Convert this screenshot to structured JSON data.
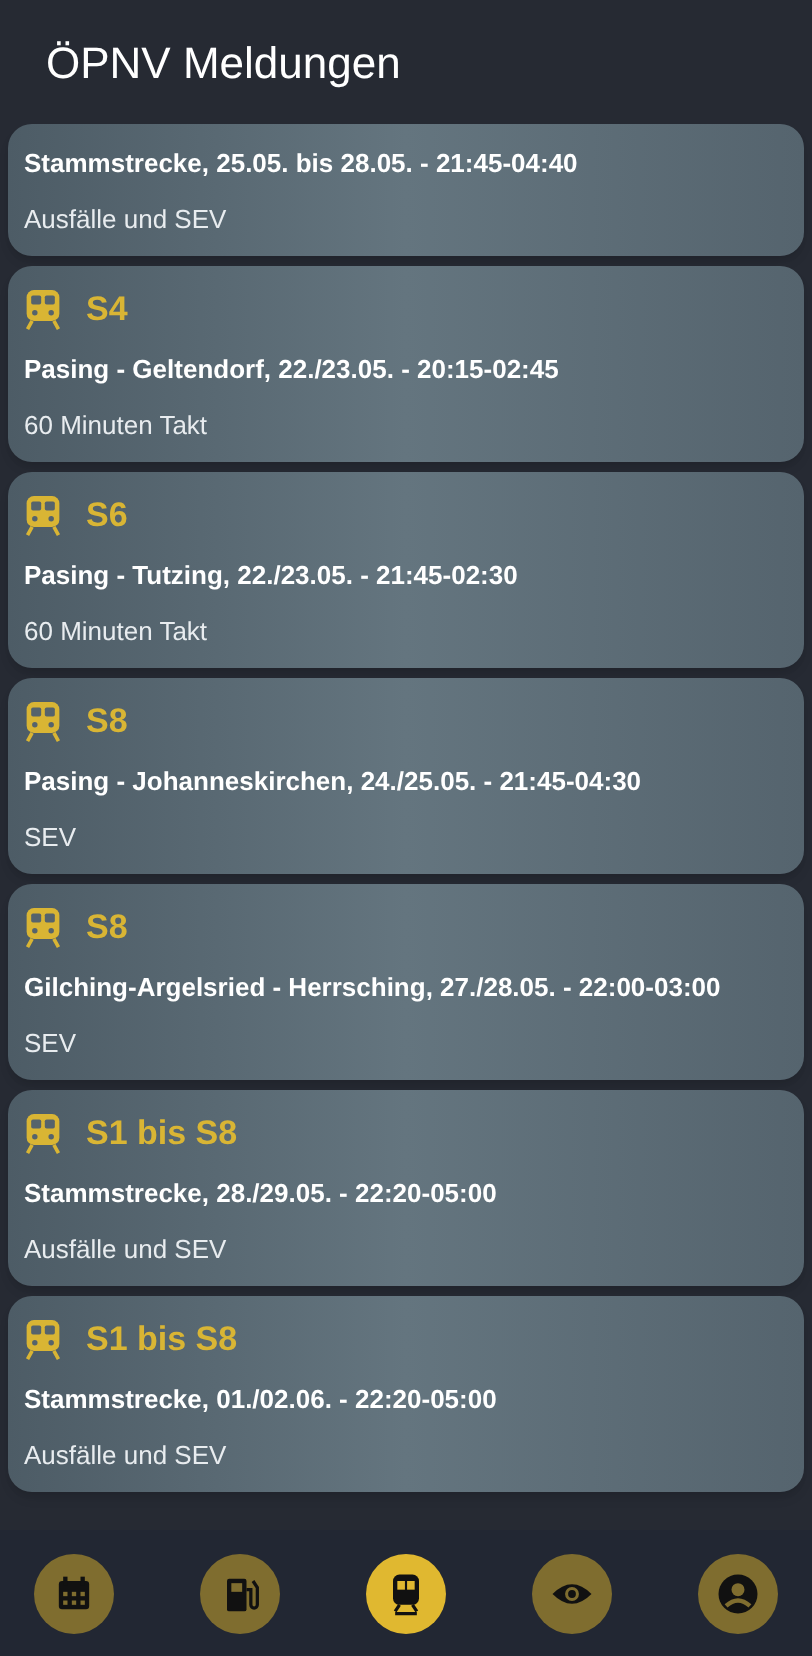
{
  "header": {
    "title": "ÖPNV Meldungen"
  },
  "messages": [
    {
      "title": "Stammstrecke, 25.05. bis 28.05. - 21:45-04:40",
      "detail": "Ausfälle und SEV"
    },
    {
      "line": "S4",
      "title": "Pasing - Geltendorf, 22./23.05. - 20:15-02:45",
      "detail": "60 Minuten Takt"
    },
    {
      "line": "S6",
      "title": "Pasing - Tutzing, 22./23.05. - 21:45-02:30",
      "detail": "60 Minuten Takt"
    },
    {
      "line": "S8",
      "title": "Pasing - Johanneskirchen, 24./25.05. - 21:45-04:30",
      "detail": "SEV"
    },
    {
      "line": "S8",
      "title": "Gilching-Argelsried - Herrsching, 27./28.05. - 22:00-03:00",
      "detail": "SEV"
    },
    {
      "line": "S1 bis S8",
      "title": "Stammstrecke, 28./29.05. - 22:20-05:00",
      "detail": "Ausfälle und SEV"
    },
    {
      "line": "S1 bis S8",
      "title": "Stammstrecke, 01./02.06. - 22:20-05:00",
      "detail": "Ausfälle und SEV"
    }
  ],
  "nav": [
    {
      "kind": "calendar",
      "selected": false
    },
    {
      "kind": "fuel",
      "selected": false
    },
    {
      "kind": "train",
      "selected": true
    },
    {
      "kind": "eye",
      "selected": false
    },
    {
      "kind": "person",
      "selected": false
    }
  ]
}
